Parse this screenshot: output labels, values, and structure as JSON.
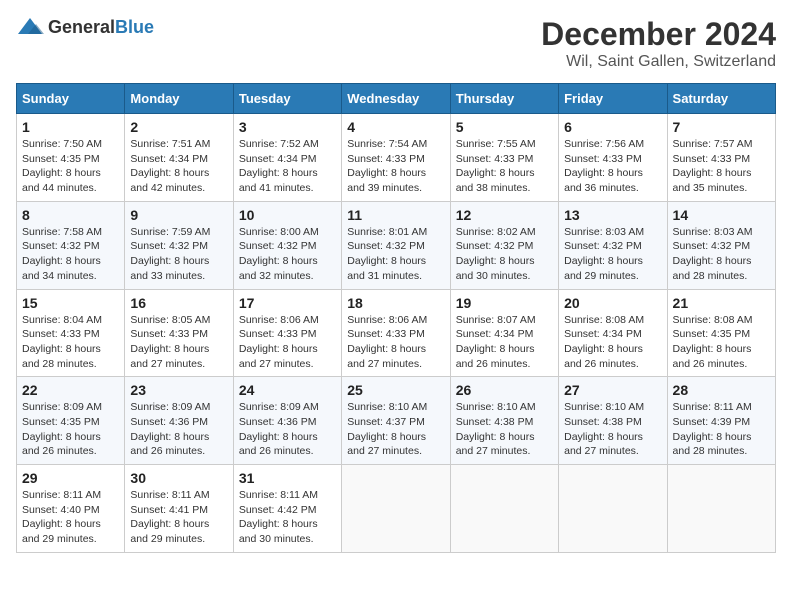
{
  "header": {
    "logo_general": "General",
    "logo_blue": "Blue",
    "month": "December 2024",
    "location": "Wil, Saint Gallen, Switzerland"
  },
  "days_of_week": [
    "Sunday",
    "Monday",
    "Tuesday",
    "Wednesday",
    "Thursday",
    "Friday",
    "Saturday"
  ],
  "weeks": [
    [
      {
        "day": "1",
        "sunrise": "7:50 AM",
        "sunset": "4:35 PM",
        "daylight": "8 hours and 44 minutes."
      },
      {
        "day": "2",
        "sunrise": "7:51 AM",
        "sunset": "4:34 PM",
        "daylight": "8 hours and 42 minutes."
      },
      {
        "day": "3",
        "sunrise": "7:52 AM",
        "sunset": "4:34 PM",
        "daylight": "8 hours and 41 minutes."
      },
      {
        "day": "4",
        "sunrise": "7:54 AM",
        "sunset": "4:33 PM",
        "daylight": "8 hours and 39 minutes."
      },
      {
        "day": "5",
        "sunrise": "7:55 AM",
        "sunset": "4:33 PM",
        "daylight": "8 hours and 38 minutes."
      },
      {
        "day": "6",
        "sunrise": "7:56 AM",
        "sunset": "4:33 PM",
        "daylight": "8 hours and 36 minutes."
      },
      {
        "day": "7",
        "sunrise": "7:57 AM",
        "sunset": "4:33 PM",
        "daylight": "8 hours and 35 minutes."
      }
    ],
    [
      {
        "day": "8",
        "sunrise": "7:58 AM",
        "sunset": "4:32 PM",
        "daylight": "8 hours and 34 minutes."
      },
      {
        "day": "9",
        "sunrise": "7:59 AM",
        "sunset": "4:32 PM",
        "daylight": "8 hours and 33 minutes."
      },
      {
        "day": "10",
        "sunrise": "8:00 AM",
        "sunset": "4:32 PM",
        "daylight": "8 hours and 32 minutes."
      },
      {
        "day": "11",
        "sunrise": "8:01 AM",
        "sunset": "4:32 PM",
        "daylight": "8 hours and 31 minutes."
      },
      {
        "day": "12",
        "sunrise": "8:02 AM",
        "sunset": "4:32 PM",
        "daylight": "8 hours and 30 minutes."
      },
      {
        "day": "13",
        "sunrise": "8:03 AM",
        "sunset": "4:32 PM",
        "daylight": "8 hours and 29 minutes."
      },
      {
        "day": "14",
        "sunrise": "8:03 AM",
        "sunset": "4:32 PM",
        "daylight": "8 hours and 28 minutes."
      }
    ],
    [
      {
        "day": "15",
        "sunrise": "8:04 AM",
        "sunset": "4:33 PM",
        "daylight": "8 hours and 28 minutes."
      },
      {
        "day": "16",
        "sunrise": "8:05 AM",
        "sunset": "4:33 PM",
        "daylight": "8 hours and 27 minutes."
      },
      {
        "day": "17",
        "sunrise": "8:06 AM",
        "sunset": "4:33 PM",
        "daylight": "8 hours and 27 minutes."
      },
      {
        "day": "18",
        "sunrise": "8:06 AM",
        "sunset": "4:33 PM",
        "daylight": "8 hours and 27 minutes."
      },
      {
        "day": "19",
        "sunrise": "8:07 AM",
        "sunset": "4:34 PM",
        "daylight": "8 hours and 26 minutes."
      },
      {
        "day": "20",
        "sunrise": "8:08 AM",
        "sunset": "4:34 PM",
        "daylight": "8 hours and 26 minutes."
      },
      {
        "day": "21",
        "sunrise": "8:08 AM",
        "sunset": "4:35 PM",
        "daylight": "8 hours and 26 minutes."
      }
    ],
    [
      {
        "day": "22",
        "sunrise": "8:09 AM",
        "sunset": "4:35 PM",
        "daylight": "8 hours and 26 minutes."
      },
      {
        "day": "23",
        "sunrise": "8:09 AM",
        "sunset": "4:36 PM",
        "daylight": "8 hours and 26 minutes."
      },
      {
        "day": "24",
        "sunrise": "8:09 AM",
        "sunset": "4:36 PM",
        "daylight": "8 hours and 26 minutes."
      },
      {
        "day": "25",
        "sunrise": "8:10 AM",
        "sunset": "4:37 PM",
        "daylight": "8 hours and 27 minutes."
      },
      {
        "day": "26",
        "sunrise": "8:10 AM",
        "sunset": "4:38 PM",
        "daylight": "8 hours and 27 minutes."
      },
      {
        "day": "27",
        "sunrise": "8:10 AM",
        "sunset": "4:38 PM",
        "daylight": "8 hours and 27 minutes."
      },
      {
        "day": "28",
        "sunrise": "8:11 AM",
        "sunset": "4:39 PM",
        "daylight": "8 hours and 28 minutes."
      }
    ],
    [
      {
        "day": "29",
        "sunrise": "8:11 AM",
        "sunset": "4:40 PM",
        "daylight": "8 hours and 29 minutes."
      },
      {
        "day": "30",
        "sunrise": "8:11 AM",
        "sunset": "4:41 PM",
        "daylight": "8 hours and 29 minutes."
      },
      {
        "day": "31",
        "sunrise": "8:11 AM",
        "sunset": "4:42 PM",
        "daylight": "8 hours and 30 minutes."
      },
      null,
      null,
      null,
      null
    ]
  ]
}
